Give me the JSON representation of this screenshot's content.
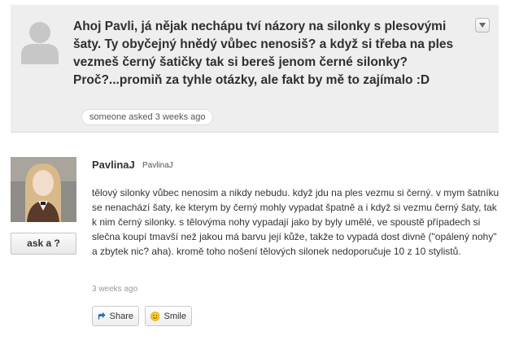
{
  "question": {
    "avatar_icon": "default-user-silhouette",
    "text": "Ahoj Pavli, já nějak nechápu tví názory na silonky s plesovými šaty. Ty obyčejný hnědý vůbec nenosiš? a když si třeba na ples vezmeš černý šatičky tak si bereš jenom černé silonky?Proč?...promiň za tyhle otázky, ale fakt by mě to zajímalo :D",
    "asked_meta": "someone asked 3 weeks ago",
    "menu_icon": "chevron-down-icon"
  },
  "answer": {
    "username": "PavlinaJ",
    "handle": "PavlinaJ",
    "ask_button_label": "ask a ?",
    "text": "tělový silonky vůbec nenosim a nikdy nebudu. když jdu na ples vezmu si černý. v mym šatníku se nenachází šaty, ke kterym by černý mohly vypadat špatně a i když si vezmu černý šaty, tak k nim černý silonky. s tělovýma nohy vypadají jako by byly umělé, ve spoustě případech si slečna koupí tmavší než jakou má barvu její kůže, takže to vypadá dost divně (\"opálený nohy\" a zbytek nic? aha). kromě toho nošení tělových silonek nedoporučuje 10 z 10 stylistů.",
    "time": "3 weeks ago",
    "share_label": "Share",
    "smile_label": "Smile",
    "share_icon": "share-icon",
    "smile_icon": "smiley-icon"
  }
}
